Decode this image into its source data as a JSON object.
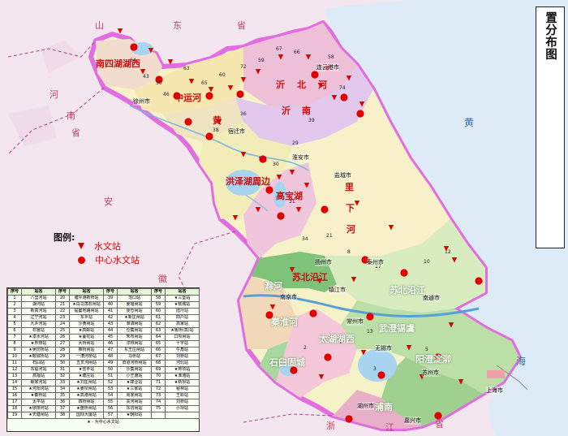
{
  "title": "江苏省中小河流水文监测系统水文站站点位置分布图",
  "legend": {
    "heading": "图例:",
    "items": [
      {
        "label": "水文站",
        "symbol": "triangle-icon"
      },
      {
        "label": "中心水文站",
        "symbol": "circle-icon"
      }
    ]
  },
  "colors": {
    "background": "#f4e6ef",
    "sea": "#dcebf6",
    "province_boundary": "#e06ee0",
    "station": "#e00000",
    "river": "#7ab8e0"
  },
  "regions": [
    {
      "name": "南四湖湖西",
      "style": "red"
    },
    {
      "name": "中运河",
      "style": "red"
    },
    {
      "name": "沂",
      "style": "red"
    },
    {
      "name": "北",
      "style": "red"
    },
    {
      "name": "河",
      "style": "red"
    },
    {
      "name": "沂",
      "style": "red"
    },
    {
      "name": "南",
      "style": "red"
    },
    {
      "name": "黄",
      "style": "red"
    },
    {
      "name": "洪泽湖周边",
      "style": "red"
    },
    {
      "name": "高宝湖",
      "style": "red"
    },
    {
      "name": "里",
      "style": "red"
    },
    {
      "name": "下",
      "style": "red"
    },
    {
      "name": "河",
      "style": "red"
    },
    {
      "name": "苏北沿江",
      "style": "red"
    },
    {
      "name": "苏北沿江",
      "style": "white"
    },
    {
      "name": "滁河",
      "style": "white"
    },
    {
      "name": "秦淮河",
      "style": "white"
    },
    {
      "name": "武澄锡虞",
      "style": "white"
    },
    {
      "name": "太湖湖西",
      "style": "white"
    },
    {
      "name": "石臼固城",
      "style": "white"
    },
    {
      "name": "阳澄淀泖",
      "style": "white"
    },
    {
      "name": "浦南",
      "style": "white"
    }
  ],
  "provinces": [
    "山",
    "东",
    "省",
    "河",
    "南",
    "省",
    "安",
    "徽",
    "浙",
    "江",
    "省",
    "海",
    "黄"
  ],
  "cities": [
    "连云港市",
    "徐州市",
    "宿迁市",
    "淮安市",
    "盐城市",
    "扬州市",
    "泰州市",
    "镇江市",
    "南京市",
    "南通市",
    "常州市",
    "无锡市",
    "苏州市",
    "上海市",
    "湖州市",
    "嘉兴市"
  ],
  "station_table": {
    "headers": [
      "序号",
      "站名",
      "序号",
      "站名",
      "序号",
      "站名",
      "序号",
      "站名"
    ],
    "rows": [
      [
        "1",
        "八里河站",
        "20",
        "塘坪港新桥站",
        "39",
        "范口站",
        "58",
        "★三堡站"
      ],
      [
        "2",
        "湖河站",
        "21",
        "★白马荡石闸站",
        "40",
        "姜堰闸站",
        "59",
        "★桃城站"
      ],
      [
        "3",
        "新高河站",
        "22",
        "提篓地路闸站",
        "41",
        "便仓闸站",
        "60",
        "陆圩站"
      ],
      [
        "4",
        "辽宁河站",
        "23",
        "东乡站",
        "42",
        "★新庄闸站",
        "61",
        "四户站"
      ],
      [
        "5",
        "九乡河站",
        "24",
        "沙黄闸站",
        "43",
        "淮泗闸站",
        "62",
        "高家站"
      ],
      [
        "6",
        "石官站",
        "25",
        "★高邮站",
        "44",
        "仓集闸站",
        "63",
        "★鲁桥(高)站"
      ],
      [
        "7",
        "★漆水河站",
        "26",
        "★蔓花站",
        "45",
        "朱布闸站",
        "64",
        "口坝闸站"
      ],
      [
        "8",
        "★界排站",
        "27",
        "大桥闸站",
        "46",
        "淳林闸站",
        "65",
        "十字站"
      ],
      [
        "9",
        "★吴坊桥站",
        "28",
        "推桥闸站",
        "47",
        "东王庄闸站",
        "66",
        "牛角站"
      ],
      [
        "10",
        "★鞍城桥站",
        "29",
        "一漕河桥站",
        "48",
        "马桥站",
        "67",
        "刘桥站"
      ],
      [
        "11",
        "石臼站",
        "30",
        "五叉河闸站",
        "49",
        "旧道河桥闸站",
        "68",
        "河北站"
      ],
      [
        "12",
        "东临河站",
        "31",
        "★雪丰站",
        "50",
        "沙集闸站",
        "69",
        "★蒋项站"
      ],
      [
        "13",
        "高堰站",
        "32",
        "★塘庄站",
        "51",
        "小王滩站",
        "70",
        "★淮滩站"
      ],
      [
        "14",
        "细家河站",
        "33",
        "★刘庄闸站",
        "52",
        "★肆业站",
        "71",
        "★新坝站"
      ],
      [
        "15",
        "★河阳河站",
        "34",
        "★姜坝闸站",
        "53",
        "★三家站",
        "72",
        "秘林站"
      ],
      [
        "16",
        "★秦桥站",
        "35",
        "★高港闸站",
        "54",
        "周家闸站",
        "73",
        "王岭站"
      ],
      [
        "17",
        "太平站",
        "36",
        "四桥闸站",
        "55",
        "关河闸站",
        "74",
        "刘桥站"
      ],
      [
        "18",
        "★徐排河站",
        "37",
        "★盘桥闸站",
        "56",
        "东坊闸站",
        "75",
        "小坝站"
      ],
      [
        "19",
        "★天塘闸站",
        "38",
        "国际大厦站",
        "57",
        "★朝阳站",
        "",
        ""
      ]
    ],
    "footnote": "★ - 为中心水文站"
  },
  "station_numbers": [
    "64",
    "43",
    "46",
    "50",
    "63",
    "65",
    "60",
    "72",
    "59",
    "67",
    "66",
    "58",
    "74",
    "36",
    "38",
    "39",
    "29",
    "30",
    "33",
    "31",
    "34",
    "21",
    "8",
    "17",
    "10",
    "12",
    "13",
    "2",
    "3",
    "5"
  ]
}
